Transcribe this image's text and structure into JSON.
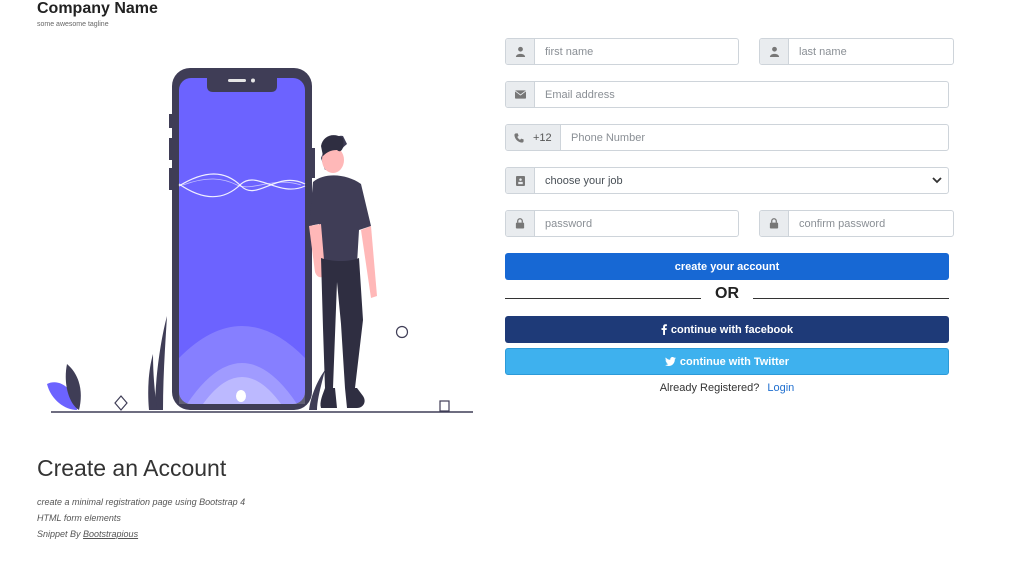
{
  "brand": {
    "name": "Company Name",
    "tagline": "some awesome tagline"
  },
  "info": {
    "title": "Create an Account",
    "line1": "create a minimal registration page using Bootstrap 4",
    "line2": "HTML form elements",
    "line3_prefix": "Snippet By ",
    "line3_link": "Bootstrapious"
  },
  "form": {
    "first_name": {
      "placeholder": "first name",
      "icon": "user-icon"
    },
    "last_name": {
      "placeholder": "last name",
      "icon": "user-icon"
    },
    "email": {
      "placeholder": "Email address",
      "icon": "envelope-icon"
    },
    "phone": {
      "code": "+12",
      "placeholder": "Phone Number",
      "icon": "phone-icon"
    },
    "job": {
      "selected": "choose your job",
      "icon": "id-card-icon"
    },
    "password": {
      "placeholder": "password",
      "icon": "lock-icon"
    },
    "confirm_password": {
      "placeholder": "confirm password",
      "icon": "lock-icon"
    },
    "create_label": "create your account",
    "or_label": "OR",
    "facebook_label": "continue with facebook",
    "twitter_label": "continue with Twitter",
    "already_text": "Already Registered?",
    "login_label": "Login"
  },
  "colors": {
    "primary": "#1768d4",
    "facebook": "#1e3a78",
    "twitter": "#3eb1ee",
    "illustration_accent": "#6c63ff",
    "illustration_dark": "#3f3d56"
  }
}
